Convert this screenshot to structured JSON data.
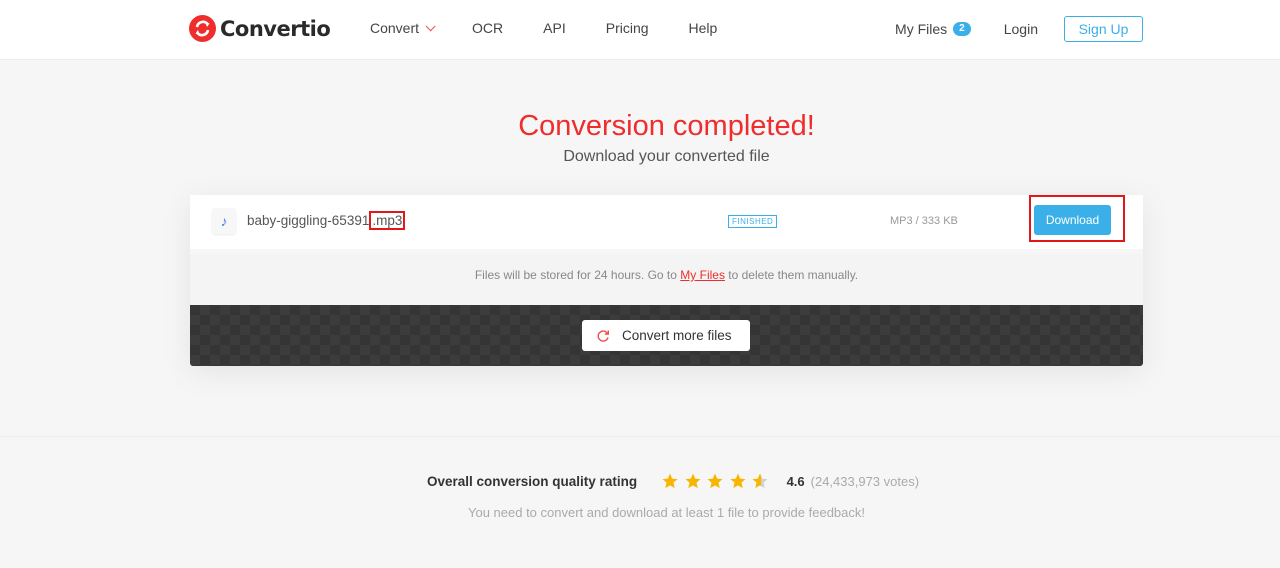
{
  "header": {
    "logo_text": "Convertio",
    "nav": [
      {
        "label": "Convert",
        "has_dropdown": true
      },
      {
        "label": "OCR"
      },
      {
        "label": "API"
      },
      {
        "label": "Pricing"
      },
      {
        "label": "Help"
      }
    ],
    "my_files_label": "My Files",
    "my_files_count": "2",
    "login_label": "Login",
    "signup_label": "Sign Up"
  },
  "hero": {
    "title": "Conversion completed!",
    "subtitle": "Download your converted file"
  },
  "file": {
    "icon": "music-note-icon",
    "name_base": "baby-giggling-65391",
    "name_ext": ".mp3",
    "status": "FINISHED",
    "meta": "MP3 / 333 KB",
    "download_label": "Download"
  },
  "notice": {
    "prefix": "Files will be stored for 24 hours. Go to ",
    "link": "My Files",
    "suffix": " to delete them manually."
  },
  "convert_more_label": "Convert more files",
  "rating": {
    "label": "Overall conversion quality rating",
    "value": "4.6",
    "stars_filled_fraction": 0.92,
    "votes": "(24,433,973 votes)",
    "feedback": "You need to convert and download at least 1 file to provide feedback!",
    "star_color": "#f7b500"
  },
  "colors": {
    "brand_red": "#ef2d2d",
    "accent_blue": "#3bb0e8"
  }
}
